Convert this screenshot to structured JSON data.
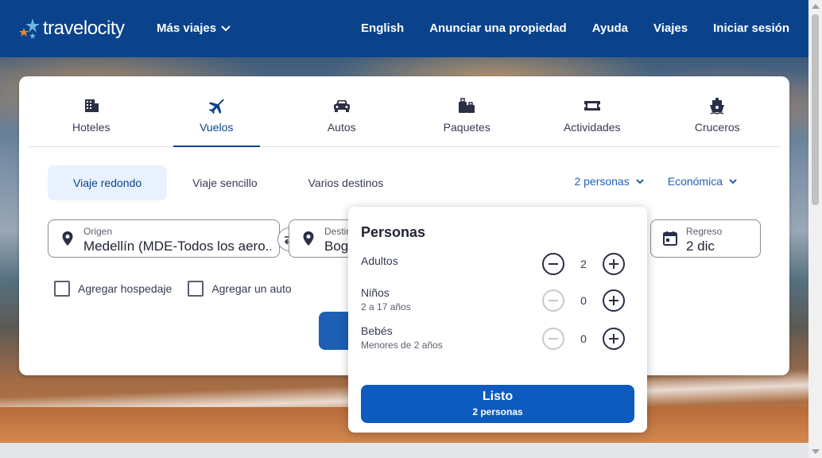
{
  "header": {
    "logo_text": "travelocity",
    "more_trips": "Más viajes",
    "nav": [
      "English",
      "Anunciar una propiedad",
      "Ayuda",
      "Viajes",
      "Iniciar sesión"
    ]
  },
  "tabs": [
    {
      "label": "Hoteles",
      "icon": "building-icon"
    },
    {
      "label": "Vuelos",
      "icon": "plane-icon"
    },
    {
      "label": "Autos",
      "icon": "car-icon"
    },
    {
      "label": "Paquetes",
      "icon": "luggage-icon"
    },
    {
      "label": "Actividades",
      "icon": "ticket-icon"
    },
    {
      "label": "Cruceros",
      "icon": "ship-icon"
    }
  ],
  "active_tab": "Vuelos",
  "trip_types": [
    "Viaje redondo",
    "Viaje sencillo",
    "Varios destinos"
  ],
  "travelers_dropdown": "2 personas",
  "class_dropdown": "Económica",
  "origin": {
    "label": "Origen",
    "value": "Medellín (MDE-Todos los aero..."
  },
  "destination": {
    "label": "Destino",
    "value": "Bogotá"
  },
  "return": {
    "label": "Regreso",
    "value": "2 dic"
  },
  "checkboxes": [
    "Agregar hospedaje",
    "Agregar un auto"
  ],
  "popover": {
    "title": "Personas",
    "rows": [
      {
        "label": "Adultos",
        "sub": "",
        "count": "2"
      },
      {
        "label": "Niños",
        "sub": "2 a 17 años",
        "count": "0"
      },
      {
        "label": "Bebés",
        "sub": "Menores de 2 años",
        "count": "0"
      }
    ],
    "done_label": "Listo",
    "done_sub": "2 personas"
  },
  "colors": {
    "brand": "#0a438b",
    "accent": "#0d5bbf",
    "light_accent": "#e8f1fd"
  }
}
